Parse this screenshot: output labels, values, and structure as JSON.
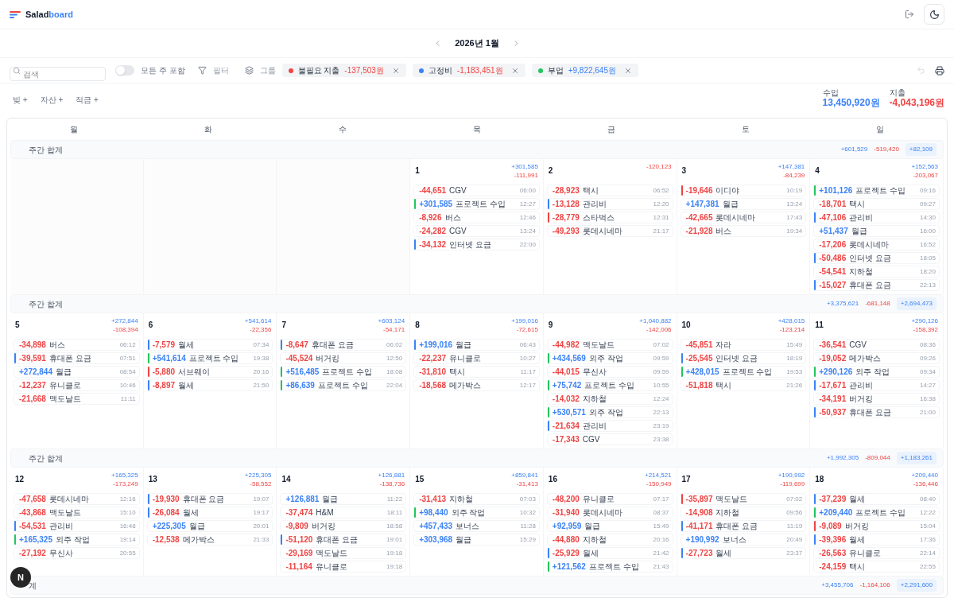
{
  "app": {
    "logo_a": "Salad",
    "logo_b": "board"
  },
  "month_nav": {
    "title": "2026년 1월"
  },
  "toolbar": {
    "search": {
      "placeholder": "검색"
    },
    "toggle": {
      "label": "모든 주 포함",
      "on": false
    },
    "filter": "필터",
    "group": "그룹",
    "chips": [
      {
        "label": "불필요 지출",
        "amount": "-137,503원",
        "kind": "expense",
        "color": "#ef4444"
      },
      {
        "label": "고정비",
        "amount": "-1,183,451원",
        "kind": "expense",
        "color": "#3b82f6"
      },
      {
        "label": "부업",
        "amount": "+9,822,645원",
        "kind": "income",
        "color": "#22c55e"
      }
    ]
  },
  "quick_add": [
    "빚 +",
    "자산 +",
    "적금 +"
  ],
  "totals": [
    {
      "label": "수입",
      "value": "13,450,920원",
      "kind": "income"
    },
    {
      "label": "지출",
      "value": "-4,043,196원",
      "kind": "expense"
    }
  ],
  "weekdays": [
    "월",
    "화",
    "수",
    "목",
    "금",
    "토",
    "일"
  ],
  "weeks": [
    {
      "label": "주간 합계",
      "income": "+601,529",
      "expense": "-519,420",
      "net": "+82,109",
      "days": [
        {
          "kind": "empty"
        },
        {
          "kind": "empty"
        },
        {
          "kind": "empty"
        },
        {
          "kind": "day",
          "date": "1",
          "income": "+301,585",
          "expense": "-111,991",
          "entries": [
            {
              "amount": "-44,651",
              "name": "CGV",
              "time": "06:00",
              "kind": "expense"
            },
            {
              "amount": "+301,585",
              "name": "프로젝트 수입",
              "time": "12:27",
              "kind": "income",
              "color": "#22c55e"
            },
            {
              "amount": "-8,926",
              "name": "버스",
              "time": "12:46",
              "kind": "expense"
            },
            {
              "amount": "-24,282",
              "name": "CGV",
              "time": "13:24",
              "kind": "expense"
            },
            {
              "amount": "-34,132",
              "name": "인터넷 요금",
              "time": "22:00",
              "kind": "expense",
              "color": "#3b82f6"
            }
          ]
        },
        {
          "kind": "day",
          "date": "2",
          "expense": "-120,123",
          "entries": [
            {
              "amount": "-28,923",
              "name": "택시",
              "time": "06:52",
              "kind": "expense"
            },
            {
              "amount": "-13,128",
              "name": "관리비",
              "time": "12:20",
              "kind": "expense",
              "color": "#3b82f6"
            },
            {
              "amount": "-28,779",
              "name": "스타벅스",
              "time": "12:31",
              "kind": "expense",
              "color": "#ef4444"
            },
            {
              "amount": "-49,293",
              "name": "롯데시네마",
              "time": "21:17",
              "kind": "expense"
            }
          ]
        },
        {
          "kind": "day",
          "date": "3",
          "income": "+147,381",
          "expense": "-84,239",
          "entries": [
            {
              "amount": "-19,646",
              "name": "이디야",
              "time": "10:19",
              "kind": "expense",
              "color": "#ef4444"
            },
            {
              "amount": "+147,381",
              "name": "월급",
              "time": "13:24",
              "kind": "income"
            },
            {
              "amount": "-42,665",
              "name": "롯데시네마",
              "time": "17:43",
              "kind": "expense"
            },
            {
              "amount": "-21,928",
              "name": "버스",
              "time": "19:34",
              "kind": "expense"
            }
          ]
        },
        {
          "kind": "day",
          "date": "4",
          "income": "+152,563",
          "expense": "-203,067",
          "entries": [
            {
              "amount": "+101,126",
              "name": "프로젝트 수입",
              "time": "09:16",
              "kind": "income",
              "color": "#22c55e"
            },
            {
              "amount": "-18,701",
              "name": "택시",
              "time": "09:27",
              "kind": "expense"
            },
            {
              "amount": "-47,106",
              "name": "관리비",
              "time": "14:30",
              "kind": "expense",
              "color": "#3b82f6"
            },
            {
              "amount": "+51,437",
              "name": "월급",
              "time": "16:00",
              "kind": "income"
            },
            {
              "amount": "-17,206",
              "name": "롯데시네마",
              "time": "16:52",
              "kind": "expense"
            },
            {
              "amount": "-50,486",
              "name": "인터넷 요금",
              "time": "18:05",
              "kind": "expense",
              "color": "#3b82f6"
            },
            {
              "amount": "-54,541",
              "name": "지하철",
              "time": "18:20",
              "kind": "expense"
            },
            {
              "amount": "-15,027",
              "name": "휴대폰 요금",
              "time": "22:13",
              "kind": "expense",
              "color": "#3b82f6"
            }
          ]
        }
      ]
    },
    {
      "label": "주간 합계",
      "income": "+3,375,621",
      "expense": "-681,148",
      "net": "+2,694,473",
      "days": [
        {
          "kind": "day",
          "date": "5",
          "income": "+272,844",
          "expense": "-108,394",
          "entries": [
            {
              "amount": "-34,898",
              "name": "버스",
              "time": "06:12",
              "kind": "expense"
            },
            {
              "amount": "-39,591",
              "name": "휴대폰 요금",
              "time": "07:51",
              "kind": "expense",
              "color": "#3b82f6"
            },
            {
              "amount": "+272,844",
              "name": "월급",
              "time": "08:54",
              "kind": "income"
            },
            {
              "amount": "-12,237",
              "name": "유니클로",
              "time": "10:46",
              "kind": "expense"
            },
            {
              "amount": "-21,668",
              "name": "맥도날드",
              "time": "11:11",
              "kind": "expense"
            }
          ]
        },
        {
          "kind": "day",
          "date": "6",
          "income": "+541,614",
          "expense": "-22,356",
          "entries": [
            {
              "amount": "-7,579",
              "name": "월세",
              "time": "07:34",
              "kind": "expense",
              "color": "#3b82f6"
            },
            {
              "amount": "+541,614",
              "name": "프로젝트 수입",
              "time": "19:38",
              "kind": "income",
              "color": "#22c55e"
            },
            {
              "amount": "-5,880",
              "name": "서브웨이",
              "time": "20:16",
              "kind": "expense",
              "color": "#ef4444"
            },
            {
              "amount": "-8,897",
              "name": "월세",
              "time": "21:50",
              "kind": "expense",
              "color": "#3b82f6"
            }
          ]
        },
        {
          "kind": "day",
          "date": "7",
          "income": "+603,124",
          "expense": "-54,171",
          "entries": [
            {
              "amount": "-8,647",
              "name": "휴대폰 요금",
              "time": "06:02",
              "kind": "expense",
              "color": "#3b82f6"
            },
            {
              "amount": "-45,524",
              "name": "버거킹",
              "time": "12:50",
              "kind": "expense"
            },
            {
              "amount": "+516,485",
              "name": "프로젝트 수입",
              "time": "18:08",
              "kind": "income",
              "color": "#22c55e"
            },
            {
              "amount": "+86,639",
              "name": "프로젝트 수입",
              "time": "22:04",
              "kind": "income",
              "color": "#22c55e"
            }
          ]
        },
        {
          "kind": "day",
          "date": "8",
          "income": "+199,016",
          "expense": "-72,615",
          "entries": [
            {
              "amount": "+199,016",
              "name": "월급",
              "time": "06:43",
              "kind": "income",
              "color": "#3b82f6"
            },
            {
              "amount": "-22,237",
              "name": "유니클로",
              "time": "10:27",
              "kind": "expense"
            },
            {
              "amount": "-31,810",
              "name": "택시",
              "time": "11:17",
              "kind": "expense"
            },
            {
              "amount": "-18,568",
              "name": "메가박스",
              "time": "12:17",
              "kind": "expense"
            }
          ]
        },
        {
          "kind": "day",
          "date": "9",
          "income": "+1,040,882",
          "expense": "-142,006",
          "entries": [
            {
              "amount": "-44,982",
              "name": "맥도날드",
              "time": "07:02",
              "kind": "expense"
            },
            {
              "amount": "+434,569",
              "name": "외주 작업",
              "time": "09:59",
              "kind": "income",
              "color": "#22c55e"
            },
            {
              "amount": "-44,015",
              "name": "무신사",
              "time": "09:59",
              "kind": "expense"
            },
            {
              "amount": "+75,742",
              "name": "프로젝트 수입",
              "time": "10:55",
              "kind": "income",
              "color": "#22c55e"
            },
            {
              "amount": "-14,032",
              "name": "지하철",
              "time": "12:24",
              "kind": "expense"
            },
            {
              "amount": "+530,571",
              "name": "외주 작업",
              "time": "22:13",
              "kind": "income",
              "color": "#22c55e"
            },
            {
              "amount": "-21,634",
              "name": "관리비",
              "time": "23:19",
              "kind": "expense",
              "color": "#3b82f6"
            },
            {
              "amount": "-17,343",
              "name": "CGV",
              "time": "23:38",
              "kind": "expense"
            }
          ]
        },
        {
          "kind": "day",
          "date": "10",
          "income": "+428,015",
          "expense": "-123,214",
          "entries": [
            {
              "amount": "-45,851",
              "name": "자라",
              "time": "15:49",
              "kind": "expense"
            },
            {
              "amount": "-25,545",
              "name": "인터넷 요금",
              "time": "18:19",
              "kind": "expense",
              "color": "#3b82f6"
            },
            {
              "amount": "+428,015",
              "name": "프로젝트 수입",
              "time": "19:53",
              "kind": "income",
              "color": "#22c55e"
            },
            {
              "amount": "-51,818",
              "name": "택시",
              "time": "21:26",
              "kind": "expense"
            }
          ]
        },
        {
          "kind": "day",
          "date": "11",
          "income": "+290,126",
          "expense": "-158,392",
          "entries": [
            {
              "amount": "-36,541",
              "name": "CGV",
              "time": "08:36",
              "kind": "expense"
            },
            {
              "amount": "-19,052",
              "name": "메가박스",
              "time": "09:26",
              "kind": "expense"
            },
            {
              "amount": "+290,126",
              "name": "외주 작업",
              "time": "09:34",
              "kind": "income",
              "color": "#22c55e"
            },
            {
              "amount": "-17,671",
              "name": "관리비",
              "time": "14:27",
              "kind": "expense",
              "color": "#3b82f6"
            },
            {
              "amount": "-34,191",
              "name": "버거킹",
              "time": "16:38",
              "kind": "expense"
            },
            {
              "amount": "-50,937",
              "name": "휴대폰 요금",
              "time": "21:00",
              "kind": "expense",
              "color": "#3b82f6"
            }
          ]
        }
      ]
    },
    {
      "label": "주간 합계",
      "income": "+1,992,305",
      "expense": "-809,044",
      "net": "+1,183,261",
      "days": [
        {
          "kind": "day",
          "date": "12",
          "income": "+165,325",
          "expense": "-173,249",
          "entries": [
            {
              "amount": "-47,658",
              "name": "롯데시네마",
              "time": "12:16",
              "kind": "expense"
            },
            {
              "amount": "-43,868",
              "name": "맥도날드",
              "time": "15:10",
              "kind": "expense"
            },
            {
              "amount": "-54,531",
              "name": "관리비",
              "time": "16:48",
              "kind": "expense",
              "color": "#3b82f6"
            },
            {
              "amount": "+165,325",
              "name": "외주 작업",
              "time": "19:14",
              "kind": "income",
              "color": "#22c55e"
            },
            {
              "amount": "-27,192",
              "name": "무신사",
              "time": "20:55",
              "kind": "expense"
            }
          ]
        },
        {
          "kind": "day",
          "date": "13",
          "income": "+225,305",
          "expense": "-58,552",
          "entries": [
            {
              "amount": "-19,930",
              "name": "휴대폰 요금",
              "time": "19:07",
              "kind": "expense",
              "color": "#3b82f6"
            },
            {
              "amount": "-26,084",
              "name": "월세",
              "time": "19:17",
              "kind": "expense",
              "color": "#3b82f6"
            },
            {
              "amount": "+225,305",
              "name": "월급",
              "time": "20:01",
              "kind": "income"
            },
            {
              "amount": "-12,538",
              "name": "메가박스",
              "time": "21:33",
              "kind": "expense"
            }
          ]
        },
        {
          "kind": "day",
          "date": "14",
          "income": "+126,881",
          "expense": "-138,736",
          "entries": [
            {
              "amount": "+126,881",
              "name": "월급",
              "time": "11:22",
              "kind": "income"
            },
            {
              "amount": "-37,474",
              "name": "H&M",
              "time": "18:11",
              "kind": "expense"
            },
            {
              "amount": "-9,809",
              "name": "버거킹",
              "time": "18:58",
              "kind": "expense"
            },
            {
              "amount": "-51,120",
              "name": "휴대폰 요금",
              "time": "19:01",
              "kind": "expense",
              "color": "#3b82f6"
            },
            {
              "amount": "-29,169",
              "name": "맥도날드",
              "time": "19:18",
              "kind": "expense"
            },
            {
              "amount": "-11,164",
              "name": "유니클로",
              "time": "19:18",
              "kind": "expense"
            }
          ]
        },
        {
          "kind": "day",
          "date": "15",
          "income": "+859,841",
          "expense": "-31,413",
          "entries": [
            {
              "amount": "-31,413",
              "name": "지하철",
              "time": "07:03",
              "kind": "expense"
            },
            {
              "amount": "+98,440",
              "name": "외주 작업",
              "time": "10:32",
              "kind": "income",
              "color": "#22c55e"
            },
            {
              "amount": "+457,433",
              "name": "보너스",
              "time": "11:28",
              "kind": "income"
            },
            {
              "amount": "+303,968",
              "name": "월급",
              "time": "15:29",
              "kind": "income"
            }
          ]
        },
        {
          "kind": "day",
          "date": "16",
          "income": "+214,521",
          "expense": "-150,949",
          "entries": [
            {
              "amount": "-48,200",
              "name": "유니클로",
              "time": "07:17",
              "kind": "expense"
            },
            {
              "amount": "-31,940",
              "name": "롯데시네마",
              "time": "08:37",
              "kind": "expense"
            },
            {
              "amount": "+92,959",
              "name": "월급",
              "time": "15:49",
              "kind": "income"
            },
            {
              "amount": "-44,880",
              "name": "지하철",
              "time": "20:16",
              "kind": "expense"
            },
            {
              "amount": "-25,929",
              "name": "월세",
              "time": "21:42",
              "kind": "expense",
              "color": "#3b82f6"
            },
            {
              "amount": "+121,562",
              "name": "프로젝트 수입",
              "time": "21:43",
              "kind": "income",
              "color": "#22c55e"
            }
          ]
        },
        {
          "kind": "day",
          "date": "17",
          "income": "+190,992",
          "expense": "-119,699",
          "entries": [
            {
              "amount": "-35,897",
              "name": "맥도날드",
              "time": "07:02",
              "kind": "expense",
              "color": "#ef4444"
            },
            {
              "amount": "-14,908",
              "name": "지하철",
              "time": "09:56",
              "kind": "expense"
            },
            {
              "amount": "-41,171",
              "name": "휴대폰 요금",
              "time": "11:19",
              "kind": "expense",
              "color": "#3b82f6"
            },
            {
              "amount": "+190,992",
              "name": "보너스",
              "time": "20:49",
              "kind": "income"
            },
            {
              "amount": "-27,723",
              "name": "월세",
              "time": "23:37",
              "kind": "expense",
              "color": "#3b82f6"
            }
          ]
        },
        {
          "kind": "day",
          "date": "18",
          "income": "+209,440",
          "expense": "-136,446",
          "entries": [
            {
              "amount": "-37,239",
              "name": "월세",
              "time": "08:40",
              "kind": "expense",
              "color": "#3b82f6"
            },
            {
              "amount": "+209,440",
              "name": "프로젝트 수입",
              "time": "12:22",
              "kind": "income",
              "color": "#22c55e"
            },
            {
              "amount": "-9,089",
              "name": "버거킹",
              "time": "15:04",
              "kind": "expense",
              "color": "#ef4444"
            },
            {
              "amount": "-39,396",
              "name": "월세",
              "time": "17:36",
              "kind": "expense",
              "color": "#3b82f6"
            },
            {
              "amount": "-26,563",
              "name": "유니클로",
              "time": "22:14",
              "kind": "expense"
            },
            {
              "amount": "-24,159",
              "name": "택시",
              "time": "22:55",
              "kind": "expense"
            }
          ]
        }
      ]
    },
    {
      "label": "계",
      "income": "+3,455,706",
      "expense": "-1,164,106",
      "net": "+2,291,600"
    }
  ],
  "dev_badge": "N"
}
